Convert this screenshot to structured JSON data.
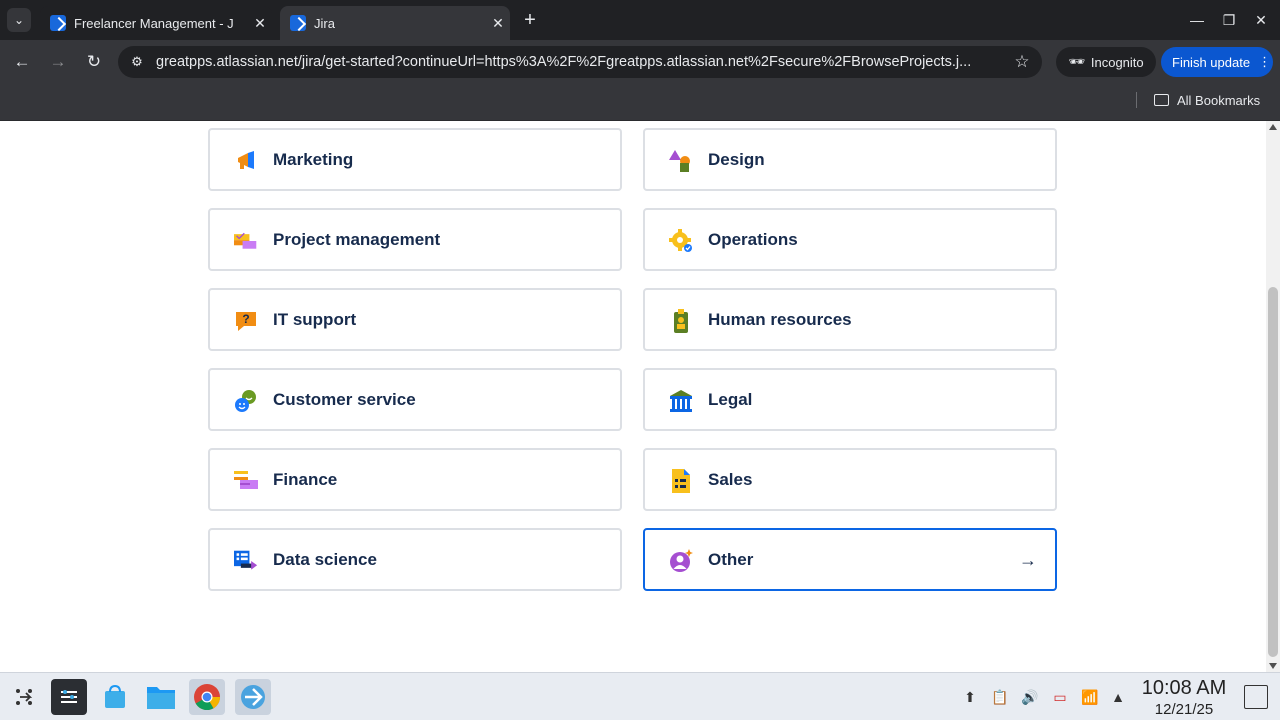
{
  "browser": {
    "tabs": [
      {
        "title": "Freelancer Management - J",
        "active": false
      },
      {
        "title": "Jira",
        "active": true
      }
    ],
    "url": "greatpps.atlassian.net/jira/get-started?continueUrl=https%3A%2F%2Fgreatpps.atlassian.net%2Fsecure%2FBrowseProjects.j...",
    "incognito_label": "Incognito",
    "finish_update_label": "Finish update",
    "all_bookmarks_label": "All Bookmarks"
  },
  "categories": [
    {
      "label": "Marketing",
      "icon": "megaphone-icon"
    },
    {
      "label": "Design",
      "icon": "shapes-icon"
    },
    {
      "label": "Project management",
      "icon": "project-board-icon"
    },
    {
      "label": "Operations",
      "icon": "gear-check-icon"
    },
    {
      "label": "IT support",
      "icon": "question-bubble-icon"
    },
    {
      "label": "Human resources",
      "icon": "badge-icon"
    },
    {
      "label": "Customer service",
      "icon": "chat-faces-icon"
    },
    {
      "label": "Legal",
      "icon": "courthouse-icon"
    },
    {
      "label": "Finance",
      "icon": "ledger-icon"
    },
    {
      "label": "Sales",
      "icon": "document-list-icon"
    },
    {
      "label": "Data science",
      "icon": "data-list-icon"
    },
    {
      "label": "Other",
      "icon": "sparkle-person-icon",
      "selected": true
    }
  ],
  "taskbar": {
    "time": "10:08 AM",
    "date": "12/21/25"
  },
  "colors": {
    "selected_border": "#0c66e4",
    "card_border": "#dcdfe4",
    "text": "#172b4d"
  }
}
